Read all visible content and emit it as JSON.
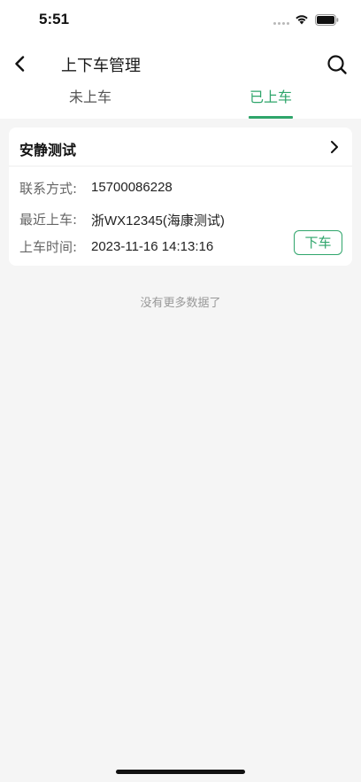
{
  "status_bar": {
    "time": "5:51"
  },
  "nav": {
    "title": "上下车管理",
    "back_icon": "chevron-left-icon",
    "search_icon": "search-icon"
  },
  "tabs": [
    {
      "label": "未上车",
      "active": false
    },
    {
      "label": "已上车",
      "active": true
    }
  ],
  "records": [
    {
      "name": "安静测试",
      "fields": [
        {
          "label": "联系方式:",
          "value": "15700086228"
        },
        {
          "label": "最近上车:",
          "value": "浙WX12345(海康测试)"
        },
        {
          "label": "上车时间:",
          "value": "2023-11-16 14:13:16"
        }
      ],
      "action_label": "下车"
    }
  ],
  "list_footer": "没有更多数据了",
  "colors": {
    "accent": "#2fa56b",
    "background": "#f5f5f5"
  }
}
